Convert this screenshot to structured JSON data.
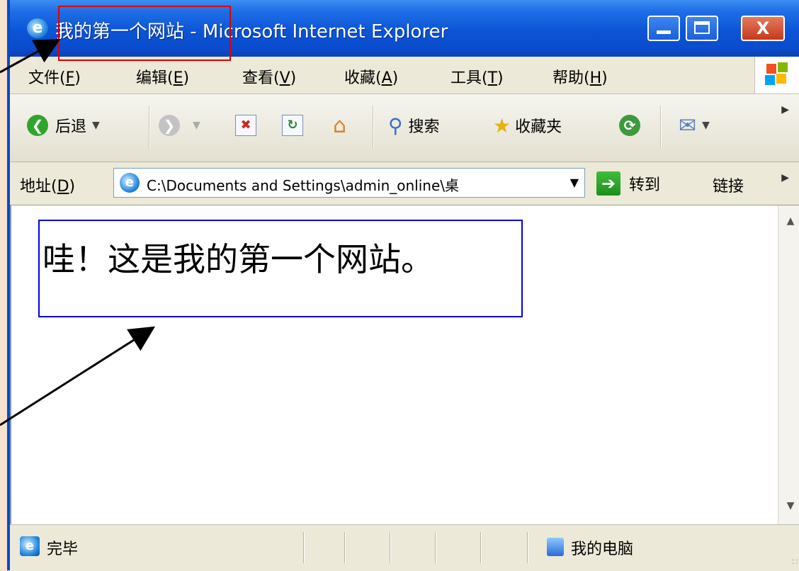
{
  "window": {
    "title": "我的第一个网站 - Microsoft Internet Explorer",
    "title_colors": {
      "bar": "#0a4ccd",
      "close": "#c4391d"
    }
  },
  "menu": {
    "items": [
      {
        "label": "文件(",
        "key": "F",
        "tail": ")"
      },
      {
        "label": "编辑(",
        "key": "E",
        "tail": ")"
      },
      {
        "label": "查看(",
        "key": "V",
        "tail": ")"
      },
      {
        "label": "收藏(",
        "key": "A",
        "tail": ")"
      },
      {
        "label": "工具(",
        "key": "T",
        "tail": ")"
      },
      {
        "label": "帮助(",
        "key": "H",
        "tail": ")"
      }
    ]
  },
  "toolbar": {
    "back_label": "后退",
    "search_label": "搜索",
    "favorites_label": "收藏夹"
  },
  "address": {
    "label": "地址(",
    "label_key": "D",
    "label_tail": ")",
    "value": "C:\\Documents and Settings\\admin_online\\桌",
    "go_label": "转到",
    "links_label": "链接"
  },
  "page": {
    "content_text": "哇！这是我的第一个网站。"
  },
  "status": {
    "text": "完毕",
    "zone": "我的电脑"
  }
}
